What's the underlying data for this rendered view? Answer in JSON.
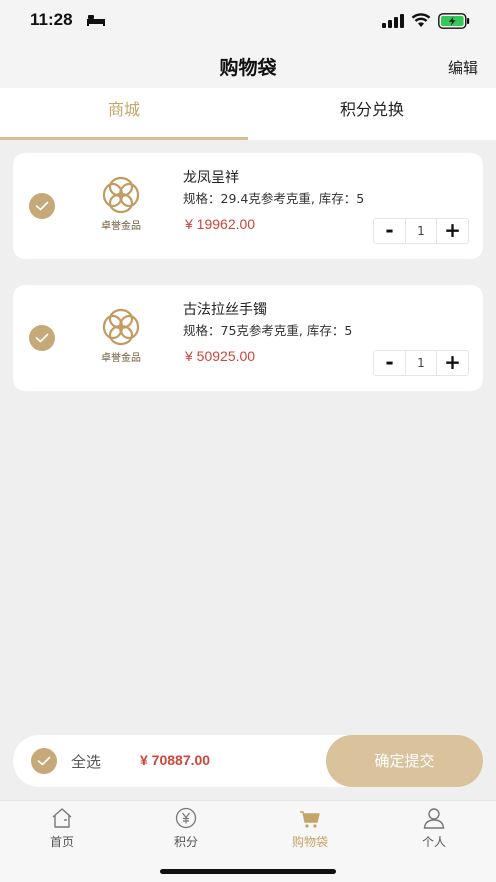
{
  "status_bar": {
    "time": "11:28"
  },
  "nav": {
    "title": "购物袋",
    "edit": "编辑"
  },
  "tabs": [
    {
      "label": "商城"
    },
    {
      "label": "积分兑换"
    }
  ],
  "logo_text": "卓誉金品",
  "items": [
    {
      "name": "龙凤呈祥",
      "spec": "规格：29.4克参考克重, 库存：5",
      "price": "¥ 19962.00",
      "qty": "1"
    },
    {
      "name": "古法拉丝手镯",
      "spec": "规格：75克参考克重, 库存：5",
      "price": "¥ 50925.00",
      "qty": "1"
    }
  ],
  "stepper": {
    "minus": "-",
    "plus": "+"
  },
  "summary": {
    "select_all": "全选",
    "total": "¥ 70887.00",
    "submit": "确定提交"
  },
  "tab_bar": [
    {
      "label": "首页",
      "icon": "home-icon"
    },
    {
      "label": "积分",
      "icon": "yen-icon"
    },
    {
      "label": "购物袋",
      "icon": "cart-icon"
    },
    {
      "label": "个人",
      "icon": "user-icon"
    }
  ],
  "colors": {
    "accent": "#c5a46a",
    "price": "#d0443a",
    "submit_bg": "#d9c29c"
  }
}
